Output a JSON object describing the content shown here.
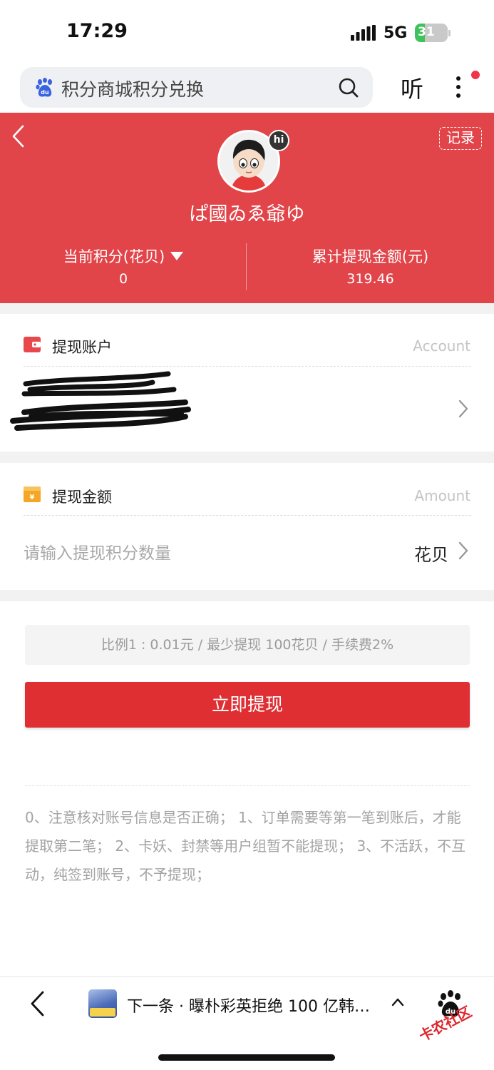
{
  "status_bar": {
    "time": "17:29",
    "network": "5G",
    "battery_percent": 31,
    "battery_label": "31"
  },
  "search": {
    "query": "积分商城积分兑换",
    "listen_label": "听",
    "icons": [
      "baidu-logo-icon",
      "search-icon",
      "more-icon"
    ]
  },
  "header": {
    "record_label": "记录",
    "hi_badge": "hi",
    "username": "ぱ國ゐゑ爺ゆ",
    "points_label": "当前积分(花贝)",
    "points_value": "0",
    "withdrawn_label": "累计提现金额(元)",
    "withdrawn_value": "319.46",
    "accent_color": "#e1454a"
  },
  "account": {
    "title": "提现账户",
    "title_en": "Account"
  },
  "amount": {
    "title": "提现金额",
    "title_en": "Amount",
    "placeholder": "请输入提现积分数量",
    "unit": "花贝"
  },
  "ratio_text": "比例1 : 0.01元 / 最少提现 100花贝 / 手续费2%",
  "submit_label": "立即提现",
  "submit_color": "#df2f33",
  "notice": "0、注意核对账号信息是否正确； 1、订单需要等第一笔到账后，才能提取第二笔； 2、卡妖、封禁等用户组暂不能提现； 3、不活跃，不互动，纯签到账号，不予提现；",
  "bottom_bar": {
    "next_title": "下一条 · 曝朴彩英拒绝 100 亿韩…",
    "watermark": "卡农社区"
  }
}
